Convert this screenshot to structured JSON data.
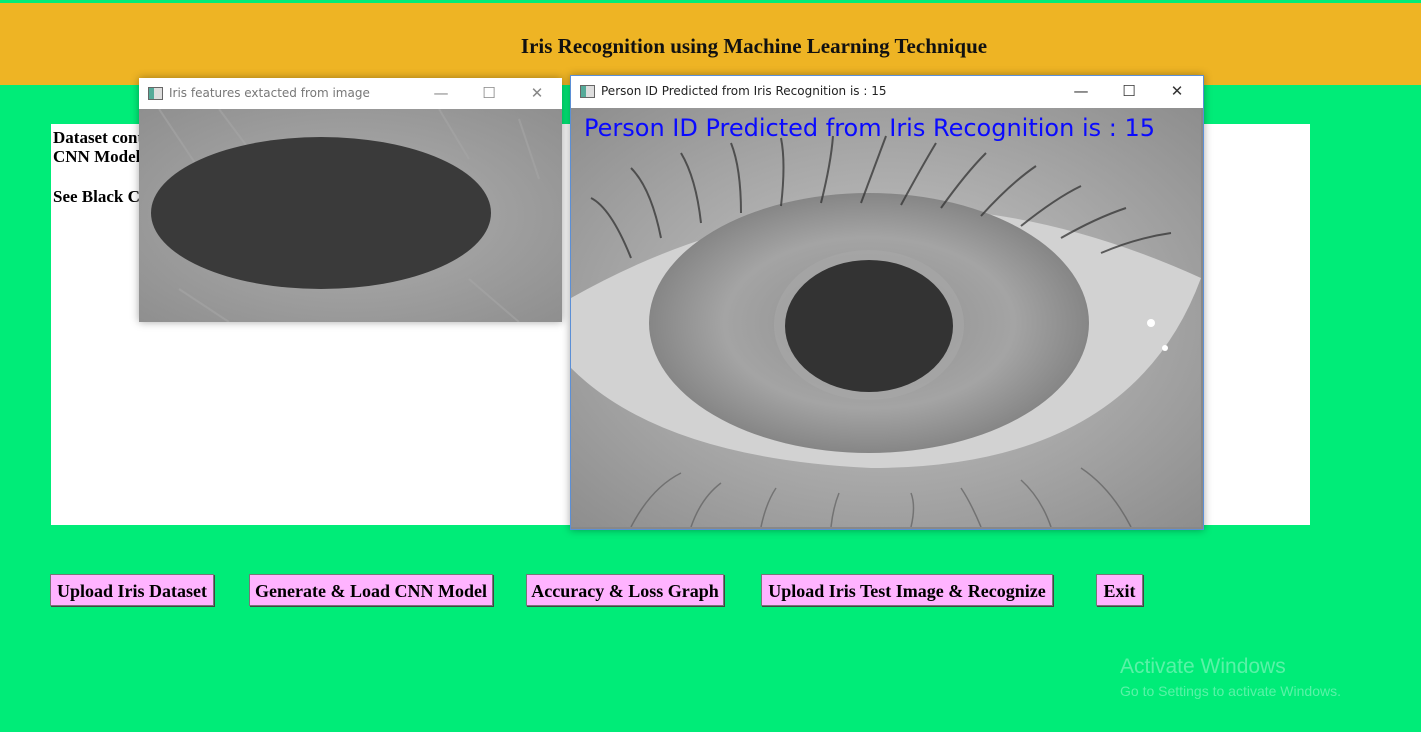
{
  "header": {
    "title": "Iris Recognition using Machine Learning Technique"
  },
  "output": {
    "lines": [
      "Dataset cont",
      "CNN Model",
      "See Black C"
    ]
  },
  "iris_window": {
    "title": "Iris features extacted from image"
  },
  "prediction_window": {
    "title": "Person ID Predicted from Iris Recognition is : 15",
    "overlay": "Person ID Predicted from Iris Recognition is : 15"
  },
  "buttons": {
    "upload_dataset": "Upload Iris Dataset",
    "generate_model": "Generate & Load CNN Model",
    "accuracy_graph": "Accuracy & Loss Graph",
    "upload_test": "Upload Iris Test Image & Recognize",
    "exit": "Exit"
  },
  "window_controls": {
    "minimize": "—",
    "maximize": "☐",
    "close": "✕"
  },
  "watermark": {
    "line1": "Activate Windows",
    "line2": "Go to Settings to activate Windows."
  },
  "colors": {
    "background": "#00ec78",
    "header": "#eeb424",
    "button": "#ffb3ff",
    "overlay_text": "#0a0aff"
  }
}
